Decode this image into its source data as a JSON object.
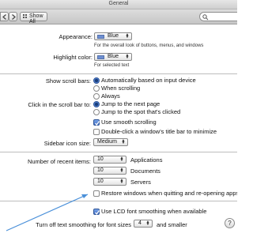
{
  "window": {
    "title": "General"
  },
  "toolbar": {
    "show_all_label": "Show All"
  },
  "appearance": {
    "label": "Appearance:",
    "value": "Blue",
    "caption": "For the overall look of buttons, menus, and windows"
  },
  "highlight": {
    "label": "Highlight color:",
    "value": "Blue",
    "caption": "For selected text",
    "swatch_color": "#6e8fd3"
  },
  "scroll_bars": {
    "label": "Show scroll bars:",
    "options": [
      "Automatically based on input device",
      "When scrolling",
      "Always"
    ],
    "selected_index": 0
  },
  "click_scroll": {
    "label": "Click in the scroll bar to:",
    "options": [
      "Jump to the next page",
      "Jump to the spot that's clicked"
    ],
    "selected_index": 0
  },
  "smooth_scrolling": {
    "label": "Use smooth scrolling",
    "checked": true
  },
  "double_click": {
    "label": "Double-click a window's title bar to minimize",
    "checked": false
  },
  "sidebar_icon": {
    "label": "Sidebar icon size:",
    "value": "Medium"
  },
  "recent_items": {
    "label": "Number of recent items:",
    "rows": [
      {
        "value": "10",
        "label": "Applications"
      },
      {
        "value": "10",
        "label": "Documents"
      },
      {
        "value": "10",
        "label": "Servers"
      }
    ]
  },
  "restore_windows": {
    "label": "Restore windows when quitting and re-opening apps",
    "checked": false
  },
  "lcd_smoothing": {
    "label": "Use LCD font smoothing when available",
    "checked": true
  },
  "text_smoothing": {
    "label": "Turn off text smoothing for font sizes",
    "value": "4",
    "suffix": "and smaller"
  },
  "help_symbol": "?",
  "colors": {
    "accent": "#3f6cc4",
    "annotation_arrow": "#4a90d9"
  }
}
